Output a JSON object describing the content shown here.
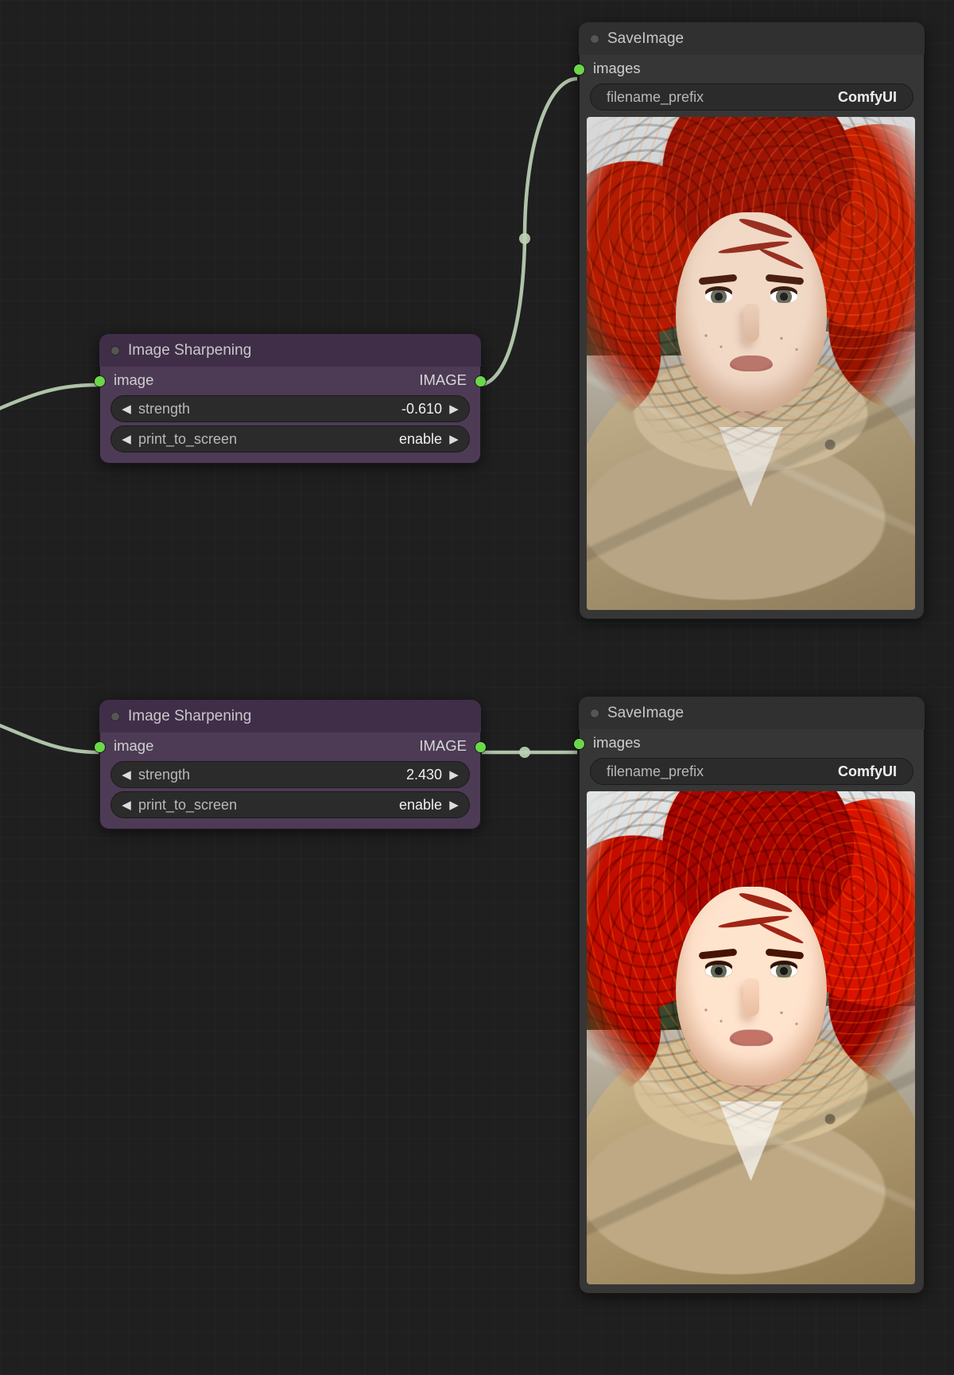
{
  "nodes": {
    "sharpen1": {
      "title": "Image Sharpening",
      "input_label": "image",
      "output_label": "IMAGE",
      "widgets": {
        "strength": {
          "name": "strength",
          "value": "-0.610"
        },
        "print": {
          "name": "print_to_screen",
          "value": "enable"
        }
      }
    },
    "sharpen2": {
      "title": "Image Sharpening",
      "input_label": "image",
      "output_label": "IMAGE",
      "widgets": {
        "strength": {
          "name": "strength",
          "value": "2.430"
        },
        "print": {
          "name": "print_to_screen",
          "value": "enable"
        }
      }
    },
    "save1": {
      "title": "SaveImage",
      "input_label": "images",
      "widgets": {
        "prefix": {
          "name": "filename_prefix",
          "value": "ComfyUI"
        }
      }
    },
    "save2": {
      "title": "SaveImage",
      "input_label": "images",
      "widgets": {
        "prefix": {
          "name": "filename_prefix",
          "value": "ComfyUI"
        }
      }
    }
  }
}
